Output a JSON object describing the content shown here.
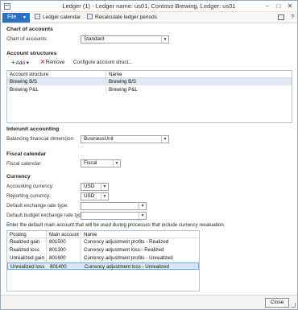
{
  "window": {
    "title": "Ledger (1) - Ledger name: us01, Contoso Brewing, Ledger: us01",
    "min_glyph": "–",
    "max_glyph": "□",
    "close_glyph": "✕"
  },
  "ribbon": {
    "file_label": "File",
    "file_caret": "▼",
    "ledger_calendar_label": "Ledger calendar",
    "recalc_label": "Recalculate ledger periods",
    "help_glyph": "?"
  },
  "chart_of_accounts": {
    "section_title": "Chart of accounts",
    "field_label": "Chart of accounts:",
    "value": "Standard"
  },
  "account_structures": {
    "section_title": "Account structures",
    "add_label": "Add",
    "add_caret": "▾",
    "remove_label": "Remove",
    "configure_label": "Configure account struct...",
    "columns": [
      "Account structure",
      "Name"
    ],
    "rows": [
      [
        "Brewing B/S",
        "Brewing B/S"
      ],
      [
        "Brewing P&L",
        "Brewing P&L"
      ]
    ]
  },
  "interunit": {
    "section_title": "Interunit accounting",
    "field_label": "Balancing financial dimension:",
    "value": "BusinessUnit"
  },
  "fiscal": {
    "section_title": "Fiscal calendar",
    "field_label": "Fiscal calendar:",
    "value": "Fiscal"
  },
  "currency": {
    "section_title": "Currency",
    "accounting_label": "Accounting currency:",
    "accounting_value": "USD",
    "reporting_label": "Reporting currency:",
    "reporting_value": "USD",
    "default_rate_label": "Default exchange rate type:",
    "default_rate_value": "",
    "budget_rate_label": "Default budget exchange rate type:",
    "budget_rate_value": "",
    "info": "Enter the default main account that will be used during processes that include currency revaluation.",
    "columns": [
      "Posting",
      "Main account",
      "Name"
    ],
    "rows": [
      [
        "Realized gain",
        "801500",
        "Currency adjustment profits - Realized"
      ],
      [
        "Realized loss",
        "801300",
        "Currency adjustment loss - Realized"
      ],
      [
        "Unrealized gain",
        "801600",
        "Currency adjustment profits - Unrealized"
      ],
      [
        "Unrealized loss",
        "801400",
        "Currency adjustment loss - Unrealized"
      ]
    ]
  },
  "footer": {
    "close_label": "Close"
  },
  "dropdown_glyph": "▼"
}
